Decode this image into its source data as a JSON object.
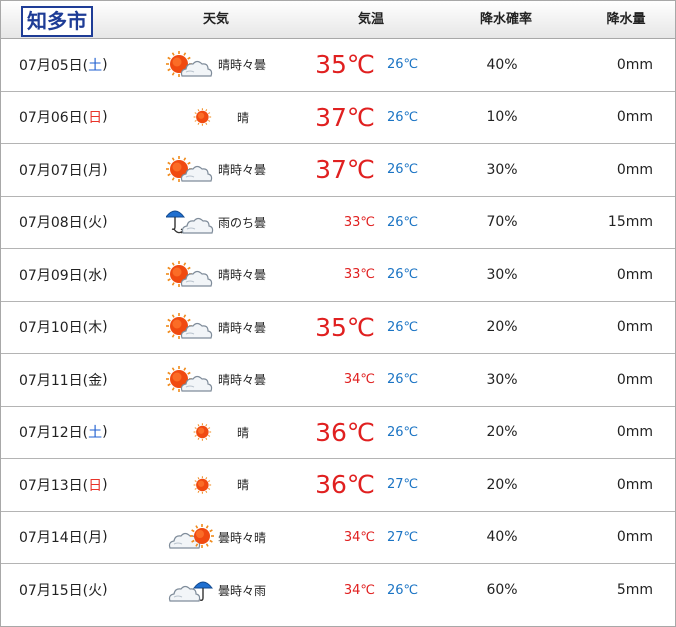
{
  "city": "知多市",
  "headers": {
    "tenki": "天気",
    "kion": "気温",
    "kousui": "降水確率",
    "ryou": "降水量"
  },
  "colors": {
    "max_temp": "#e02020",
    "min_temp": "#1b74c4",
    "saturday": "#1f5fd0",
    "sunday": "#e8342a"
  },
  "rows": [
    {
      "date_prefix": "07月05日(",
      "weekday": "土",
      "date_suffix": ")",
      "day_type": "sat",
      "icon": "sun-cloud-icon",
      "weather": "晴時々曇",
      "max": "35℃",
      "max_style": "big",
      "min": "26℃",
      "prob": "40%",
      "amount": "0mm"
    },
    {
      "date_prefix": "07月06日(",
      "weekday": "日",
      "date_suffix": ")",
      "day_type": "sun",
      "icon": "sun-icon",
      "weather": "晴",
      "max": "37℃",
      "max_style": "big",
      "min": "26℃",
      "prob": "10%",
      "amount": "0mm"
    },
    {
      "date_prefix": "07月07日(",
      "weekday": "月",
      "date_suffix": ")",
      "day_type": "weekday",
      "icon": "sun-cloud-icon",
      "weather": "晴時々曇",
      "max": "37℃",
      "max_style": "big",
      "min": "26℃",
      "prob": "30%",
      "amount": "0mm"
    },
    {
      "date_prefix": "07月08日(",
      "weekday": "火",
      "date_suffix": ")",
      "day_type": "weekday",
      "icon": "rain-then-cloud-icon",
      "weather": "雨のち曇",
      "max": "33℃",
      "max_style": "small",
      "min": "26℃",
      "prob": "70%",
      "amount": "15mm"
    },
    {
      "date_prefix": "07月09日(",
      "weekday": "水",
      "date_suffix": ")",
      "day_type": "weekday",
      "icon": "sun-cloud-icon",
      "weather": "晴時々曇",
      "max": "33℃",
      "max_style": "small",
      "min": "26℃",
      "prob": "30%",
      "amount": "0mm"
    },
    {
      "date_prefix": "07月10日(",
      "weekday": "木",
      "date_suffix": ")",
      "day_type": "weekday",
      "icon": "sun-cloud-icon",
      "weather": "晴時々曇",
      "max": "35℃",
      "max_style": "big",
      "min": "26℃",
      "prob": "20%",
      "amount": "0mm"
    },
    {
      "date_prefix": "07月11日(",
      "weekday": "金",
      "date_suffix": ")",
      "day_type": "weekday",
      "icon": "sun-cloud-icon",
      "weather": "晴時々曇",
      "max": "34℃",
      "max_style": "small",
      "min": "26℃",
      "prob": "30%",
      "amount": "0mm"
    },
    {
      "date_prefix": "07月12日(",
      "weekday": "土",
      "date_suffix": ")",
      "day_type": "sat",
      "icon": "sun-icon",
      "weather": "晴",
      "max": "36℃",
      "max_style": "big",
      "min": "26℃",
      "prob": "20%",
      "amount": "0mm"
    },
    {
      "date_prefix": "07月13日(",
      "weekday": "日",
      "date_suffix": ")",
      "day_type": "sun",
      "icon": "sun-icon",
      "weather": "晴",
      "max": "36℃",
      "max_style": "big",
      "min": "27℃",
      "prob": "20%",
      "amount": "0mm"
    },
    {
      "date_prefix": "07月14日(",
      "weekday": "月",
      "date_suffix": ")",
      "day_type": "weekday",
      "icon": "cloud-sun-icon",
      "weather": "曇時々晴",
      "max": "34℃",
      "max_style": "small",
      "min": "27℃",
      "prob": "40%",
      "amount": "0mm"
    },
    {
      "date_prefix": "07月15日(",
      "weekday": "火",
      "date_suffix": ")",
      "day_type": "weekday",
      "icon": "cloud-umbrella-icon",
      "weather": "曇時々雨",
      "max": "34℃",
      "max_style": "small",
      "min": "26℃",
      "prob": "60%",
      "amount": "5mm"
    }
  ]
}
